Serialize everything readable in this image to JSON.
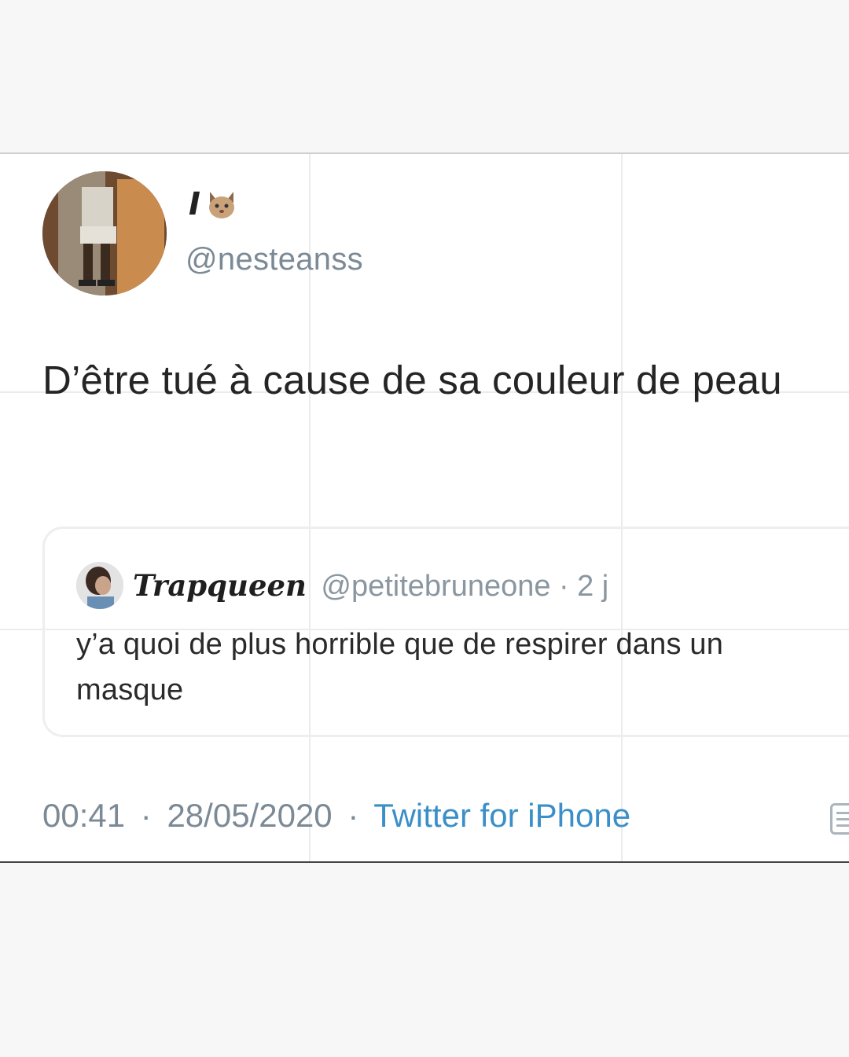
{
  "tweet": {
    "author": {
      "display_name": "I",
      "name_emoji_icon": "cat-face-icon",
      "handle": "@nesteanss"
    },
    "text": "D’être tué à cause de sa couleur de peau",
    "quoted_tweet": {
      "name": "Trapqueen",
      "handle": "@petitebruneone",
      "separator": "·",
      "time": "2 j",
      "text": "y’a quoi de plus horrible que de respirer dans un masque"
    },
    "time": "00:41",
    "separator": "·",
    "date": "28/05/2020",
    "source": "Twitter for iPhone"
  },
  "colors": {
    "background": "#f7f7f7",
    "card": "#ffffff",
    "secondary_text": "#7c8a96",
    "link": "#3a8fc9"
  }
}
